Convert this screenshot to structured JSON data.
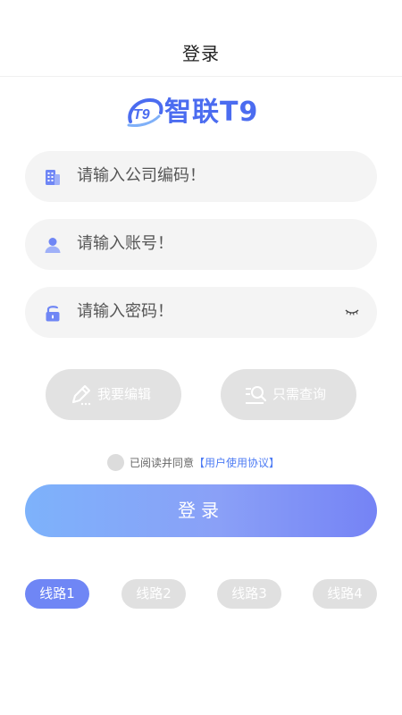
{
  "header": {
    "title": "登录"
  },
  "logo": {
    "mark": "T9",
    "text": "智联T9"
  },
  "fields": {
    "company": {
      "placeholder": "请输入公司编码！",
      "icon": "building-icon"
    },
    "account": {
      "placeholder": "请输入账号！",
      "icon": "user-icon"
    },
    "password": {
      "placeholder": "请输入密码！",
      "icon": "lock-icon",
      "toggle_icon": "eye-closed-icon"
    }
  },
  "modes": {
    "edit": {
      "label": "我要编辑",
      "icon": "pencil-icon"
    },
    "query": {
      "label": "只需查询",
      "icon": "search-list-icon"
    }
  },
  "agreement": {
    "text": "已阅读并同意",
    "link": "【用户使用协议】"
  },
  "login_button": "登录",
  "routes": [
    {
      "label": "线路1",
      "active": true
    },
    {
      "label": "线路2",
      "active": false
    },
    {
      "label": "线路3",
      "active": false
    },
    {
      "label": "线路4",
      "active": false
    }
  ],
  "colors": {
    "accent": "#6f86f5",
    "brand": "#4b6cf0",
    "link": "#4e7cf4"
  }
}
